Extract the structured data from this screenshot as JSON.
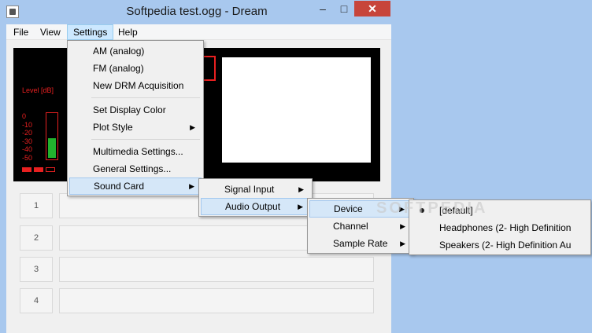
{
  "window": {
    "title": "Softpedia test.ogg - Dream",
    "controls": {
      "minimize": "–",
      "maximize": "□",
      "close": "✕"
    }
  },
  "menubar": {
    "items": [
      "File",
      "View",
      "Settings",
      "Help"
    ]
  },
  "display": {
    "level_label": "Level [dB]",
    "scale": [
      "0",
      "-10",
      "-20",
      "-30",
      "-40",
      "-50"
    ],
    "level_fraction": 0.45,
    "colors": {
      "red": "#e82020",
      "green": "#22b22e"
    }
  },
  "rows": [
    "1",
    "2",
    "3",
    "4"
  ],
  "settings_menu": {
    "items": [
      "AM (analog)",
      "FM (analog)",
      "New DRM Acquisition",
      "Set Display Color",
      "Plot Style",
      "Multimedia Settings...",
      "General Settings...",
      "Sound Card"
    ]
  },
  "sound_card_menu": {
    "items": [
      "Signal Input",
      "Audio Output"
    ]
  },
  "audio_output_menu": {
    "items": [
      "Device",
      "Channel",
      "Sample Rate"
    ]
  },
  "device_menu": {
    "items": [
      "[default]",
      "Headphones (2- High Definition",
      "Speakers (2- High Definition Au"
    ]
  },
  "watermark": "SOFTPEDIA"
}
